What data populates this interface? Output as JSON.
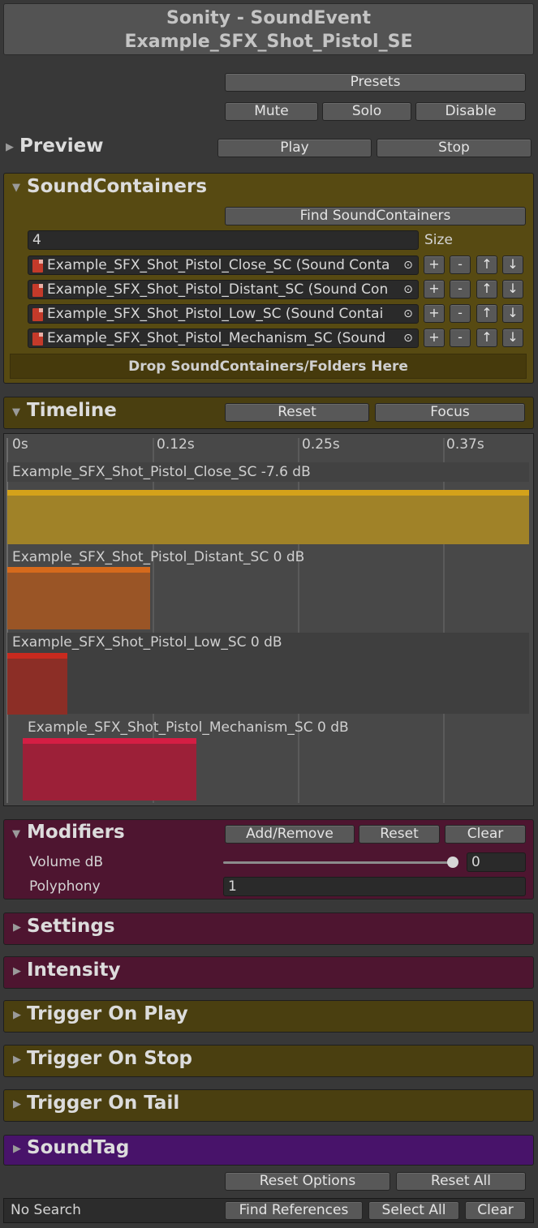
{
  "header": {
    "line1": "Sonity - SoundEvent",
    "line2": "Example_SFX_Shot_Pistol_SE"
  },
  "top_buttons": {
    "presets": "Presets",
    "mute": "Mute",
    "solo": "Solo",
    "disable": "Disable"
  },
  "preview": {
    "title": "Preview",
    "play": "Play",
    "stop": "Stop"
  },
  "sound_containers": {
    "title": "SoundContainers",
    "find": "Find SoundContainers",
    "size_value": "4",
    "size_label": "Size",
    "items": [
      {
        "name": "Example_SFX_Shot_Pistol_Close_SC (Sound Conta"
      },
      {
        "name": "Example_SFX_Shot_Pistol_Distant_SC (Sound Con"
      },
      {
        "name": "Example_SFX_Shot_Pistol_Low_SC (Sound Contai"
      },
      {
        "name": "Example_SFX_Shot_Pistol_Mechanism_SC (Sound "
      }
    ],
    "row_buttons": {
      "pick": "⊙",
      "add": "+",
      "remove": "-",
      "up": "↑",
      "down": "↓"
    },
    "drop_label": "Drop SoundContainers/Folders Here"
  },
  "timeline": {
    "title": "Timeline",
    "reset": "Reset",
    "focus": "Focus",
    "ticks": [
      "0s",
      "0.12s",
      "0.25s",
      "0.37s"
    ],
    "tracks": [
      {
        "label": "Example_SFX_Shot_Pistol_Close_SC -7.6 dB",
        "color": "#a08228",
        "top_color": "#d4a21a"
      },
      {
        "label": "Example_SFX_Shot_Pistol_Distant_SC 0 dB",
        "color": "#9a5526",
        "top_color": "#d66a1c"
      },
      {
        "label": "Example_SFX_Shot_Pistol_Low_SC 0 dB",
        "color": "#8c2e26",
        "top_color": "#c82a1e"
      },
      {
        "label": "Example_SFX_Shot_Pistol_Mechanism_SC 0 dB",
        "color": "#9c2038",
        "top_color": "#d41e44"
      }
    ]
  },
  "modifiers": {
    "title": "Modifiers",
    "add_remove": "Add/Remove",
    "reset": "Reset",
    "clear": "Clear",
    "volume_label": "Volume dB",
    "volume_value": "0",
    "polyphony_label": "Polyphony",
    "polyphony_value": "1"
  },
  "sections": {
    "settings": "Settings",
    "intensity": "Intensity",
    "trigger_on_play": "Trigger On Play",
    "trigger_on_stop": "Trigger On Stop",
    "trigger_on_tail": "Trigger On Tail",
    "sound_tag": "SoundTag"
  },
  "footer": {
    "reset_options": "Reset Options",
    "reset_all": "Reset All",
    "search_status": "No Search",
    "find_references": "Find References",
    "select_all": "Select All",
    "clear": "Clear"
  },
  "colors": {
    "olive_panel": "#574a12",
    "maroon_panel": "#4e1530",
    "purple_panel": "#48136a",
    "background": "#383838"
  }
}
